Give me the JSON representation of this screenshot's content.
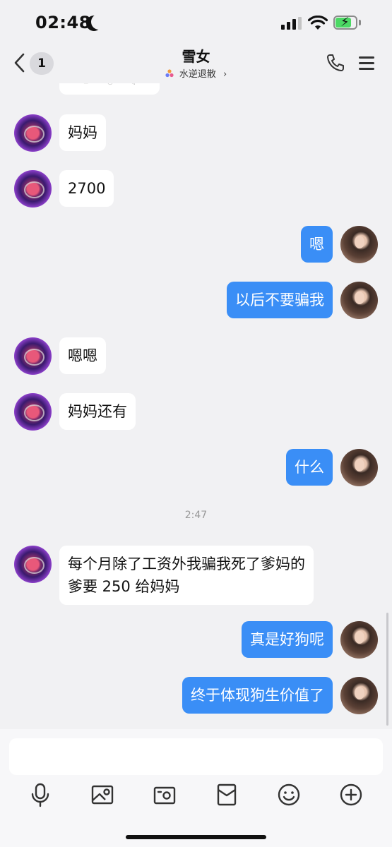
{
  "status_bar": {
    "time": "02:48",
    "icons": [
      "moon-icon",
      "cellular-signal-icon",
      "wifi-icon",
      "battery-charging-icon"
    ],
    "battery_color": "#4cd964"
  },
  "header": {
    "back_icon": "chevron-left-icon",
    "unread_count": "1",
    "title": "雪女",
    "subtitle": "水逆退散",
    "subtitle_icon": "tri-color-logo-icon",
    "right_icons": [
      "phone-icon",
      "menu-icon"
    ]
  },
  "chat": {
    "partial_card_glyphs": [
      "≡",
      "○",
      "◁"
    ],
    "messages": [
      {
        "side": "in",
        "text": "妈妈"
      },
      {
        "side": "in",
        "text": "2700"
      },
      {
        "side": "out",
        "text": "嗯"
      },
      {
        "side": "out",
        "text": "以后不要骗我"
      },
      {
        "side": "in",
        "text": "嗯嗯"
      },
      {
        "side": "in",
        "text": "妈妈还有"
      },
      {
        "side": "out",
        "text": "什么"
      },
      {
        "side": "timestamp",
        "text": "2:47"
      },
      {
        "side": "in",
        "text": "每个月除了工资外我骗我死了爹妈的",
        "text2": "爹要 250 给妈妈"
      },
      {
        "side": "out",
        "text": "真是好狗呢"
      },
      {
        "side": "out",
        "text": "终于体现狗生价值了"
      }
    ],
    "incoming_bubble_color": "#ffffff",
    "outgoing_bubble_color": "#3a8ef6"
  },
  "input_bar": {
    "value": "",
    "tools": [
      "microphone-icon",
      "image-icon",
      "camera-icon",
      "red-packet-icon",
      "emoji-icon",
      "plus-icon"
    ]
  }
}
